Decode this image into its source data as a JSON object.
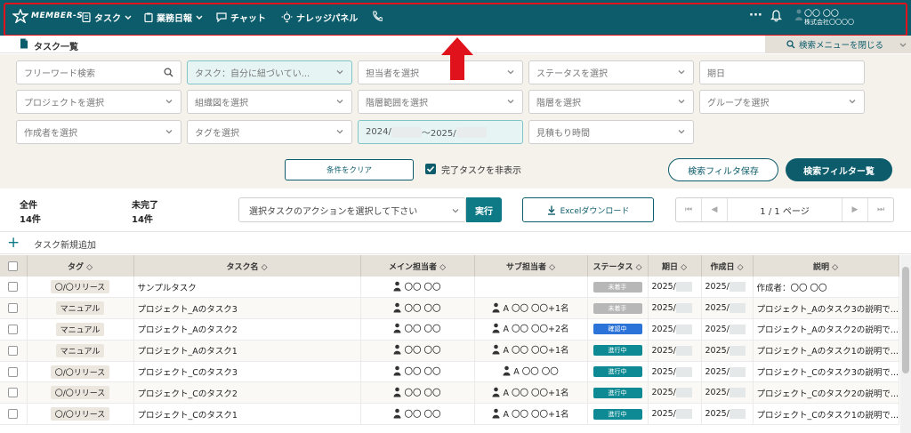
{
  "nav": {
    "logo": "MEMBER-S",
    "items": [
      {
        "label": "タスク"
      },
      {
        "label": "業務日報"
      },
      {
        "label": "チャット"
      },
      {
        "label": "ナレッジパネル"
      }
    ],
    "more": "···",
    "user_name": "〇〇 〇〇",
    "user_company": "株式会社〇〇〇〇"
  },
  "header": {
    "title": "タスク一覧",
    "close_search": "検索メニューを閉じる"
  },
  "filters": {
    "keyword_placeholder": "フリーワード検索",
    "task_scope": "タスク：自分に紐づいてい...",
    "assignee": "担当者を選択",
    "status": "ステータスを選択",
    "due": "期日",
    "project": "プロジェクトを選択",
    "org": "組織図を選択",
    "hierarchy_range": "階層範囲を選択",
    "hierarchy": "階層を選択",
    "group": "グループを選択",
    "author": "作成者を選択",
    "tag": "タグを選択",
    "date_from": "2024/",
    "date_sep": "〜2025/",
    "estimate": "見積もり時間"
  },
  "buttons": {
    "clear": "条件をクリア",
    "hide_done": "完了タスクを非表示",
    "save_filter": "検索フィルタ保存",
    "filter": "検索フィルター覧",
    "action_select": "選択タスクのアクションを選択して下さい",
    "exec": "実行",
    "excel": "Excelダウンロード"
  },
  "counts": {
    "all_label": "全件",
    "all_value": "14件",
    "incomplete_label": "未完了",
    "incomplete_value": "14件"
  },
  "pager": {
    "info": "1 / 1 ページ"
  },
  "new_task": "タスク新規追加",
  "table": {
    "columns": [
      "タグ",
      "タスク名",
      "メイン担当者",
      "サブ担当者",
      "ステータス",
      "期日",
      "作成日",
      "説明"
    ],
    "rows": [
      {
        "tag": "〇/〇リリース",
        "name": "サンプルタスク",
        "main": "〇〇 〇〇",
        "sub": "",
        "status": "未着手",
        "due": "2025/",
        "created": "2025/",
        "desc": "作成者：〇〇 〇〇"
      },
      {
        "tag": "マニュアル",
        "name": "プロジェクト_Aのタスク3",
        "main": "〇〇 〇〇",
        "sub": "A 〇〇 〇〇+1名",
        "status": "未着手",
        "due": "2025/",
        "created": "2025/",
        "desc": "プロジェクト_Aのタスク3の説明で..."
      },
      {
        "tag": "マニュアル",
        "name": "プロジェクト_Aのタスク2",
        "main": "〇〇 〇〇",
        "sub": "A 〇〇 〇〇+2名",
        "status": "確認中",
        "due": "2025/",
        "created": "2025/",
        "desc": "プロジェクト_Aのタスク2の説明で..."
      },
      {
        "tag": "マニュアル",
        "name": "プロジェクト_Aのタスク1",
        "main": "〇〇 〇〇",
        "sub": "A 〇〇 〇〇+1名",
        "status": "進行中",
        "due": "2025/",
        "created": "2025/",
        "desc": "プロジェクト_Aのタスク1の説明で..."
      },
      {
        "tag": "〇/〇リリース",
        "name": "プロジェクト_Cのタスク3",
        "main": "〇〇 〇〇",
        "sub": "A 〇〇 〇〇",
        "status": "進行中",
        "due": "2025/",
        "created": "2025/",
        "desc": "プロジェクト_Cのタスク3の説明で..."
      },
      {
        "tag": "〇/〇リリース",
        "name": "プロジェクト_Cのタスク2",
        "main": "〇〇 〇〇",
        "sub": "A 〇〇 〇〇+1名",
        "status": "進行中",
        "due": "2025/",
        "created": "2025/",
        "desc": "プロジェクト_Cのタスク2の説明で..."
      },
      {
        "tag": "〇/〇リリース",
        "name": "プロジェクト_Cのタスク1",
        "main": "〇〇 〇〇",
        "sub": "A 〇〇 〇〇+1名",
        "status": "進行中",
        "due": "2025/",
        "created": "2025/",
        "desc": "プロジェクト_Cのタスク1の説明で..."
      }
    ]
  },
  "status_colors": {
    "未着手": "#b7b7b7",
    "確認中": "#2b73d8",
    "進行中": "#0d8a93"
  },
  "colors": {
    "nav": "#0d5c6b",
    "highlight": "#e0121b",
    "accent": "#0d7a86"
  }
}
